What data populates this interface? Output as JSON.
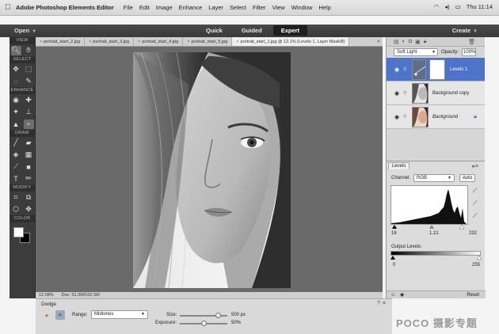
{
  "menubar": {
    "apple": "",
    "app_name": "Adobe Photoshop Elements Editor",
    "menus": [
      "File",
      "Edit",
      "Image",
      "Enhance",
      "Layer",
      "Select",
      "Filter",
      "View",
      "Window",
      "Help"
    ],
    "clock": "Thu 11:14"
  },
  "modebar": {
    "open_label": "Open",
    "modes": [
      {
        "label": "Quick",
        "active": false
      },
      {
        "label": "Guided",
        "active": false
      },
      {
        "label": "Expert",
        "active": true
      }
    ],
    "create_label": "Create"
  },
  "toolbox": {
    "sections": [
      {
        "label": "VIEW",
        "rows": [
          [
            "zoom-icon",
            "hand-icon"
          ]
        ]
      },
      {
        "label": "SELECT",
        "rows": [
          [
            "move-icon",
            "marquee-icon"
          ],
          [
            "lasso-icon",
            "quick-select-icon"
          ]
        ]
      },
      {
        "label": "ENHANCE",
        "rows": [
          [
            "red-eye-icon",
            "spot-healing-icon"
          ],
          [
            "smart-brush-icon",
            "clone-stamp-icon"
          ],
          [
            "blur-icon",
            "sponge-icon"
          ]
        ]
      },
      {
        "label": "DRAW",
        "rows": [
          [
            "brush-icon",
            "eraser-icon"
          ],
          [
            "paint-bucket-icon",
            "gradient-icon"
          ],
          [
            "color-picker-icon",
            "shape-icon"
          ],
          [
            "text-icon",
            "pencil-icon"
          ]
        ]
      },
      {
        "label": "MODIFY",
        "rows": [
          [
            "crop-icon",
            "recompose-icon"
          ],
          [
            "straighten-icon",
            "content-move-icon"
          ]
        ]
      },
      {
        "label": "COLOR",
        "rows": []
      }
    ]
  },
  "doc_tabs": [
    {
      "label": "portrait_start_2.jpg",
      "active": false
    },
    {
      "label": "portrait_start_3.jpg",
      "active": false
    },
    {
      "label": "portrait_start_4.jpg",
      "active": false
    },
    {
      "label": "portrait_start_5.jpg",
      "active": false
    },
    {
      "label": "portrait_start_1.jpg @ 12.1% (Levels 1, Layer Mask/8)",
      "active": true
    }
  ],
  "statusbar": {
    "zoom": "12.08%",
    "doc": "Doc: 51.3M/102.5M"
  },
  "options": {
    "tool_name": "Dodge",
    "range_label": "Range:",
    "range_value": "Midtones",
    "size_label": "Size:",
    "size_value": "500 px",
    "size_level": 0.8,
    "exposure_label": "Exposure:",
    "exposure_value": "50%",
    "exposure_level": 0.5
  },
  "layers": {
    "blend_mode": "Soft Light",
    "opacity_label": "Opacity:",
    "opacity_value": "100%",
    "items": [
      {
        "name": "Levels 1",
        "selected": true
      },
      {
        "name": "Background copy",
        "selected": false
      },
      {
        "name": "Background",
        "selected": false
      }
    ]
  },
  "levels": {
    "tab": "Levels",
    "channel_label": "Channel:",
    "channel_value": "RGB",
    "auto_label": "Auto",
    "input_values": [
      "16",
      "1.21",
      "232"
    ],
    "output_label": "Output Levels:",
    "output_values": [
      "0",
      "255"
    ],
    "reset_label": "Reset"
  },
  "watermark": "POCO 摄影专题",
  "colors": {
    "accent": "#4d74c8",
    "menubar": "#dcdcdc",
    "toolbox": "#3c3c3c",
    "canvas": "#6a6a6a"
  }
}
